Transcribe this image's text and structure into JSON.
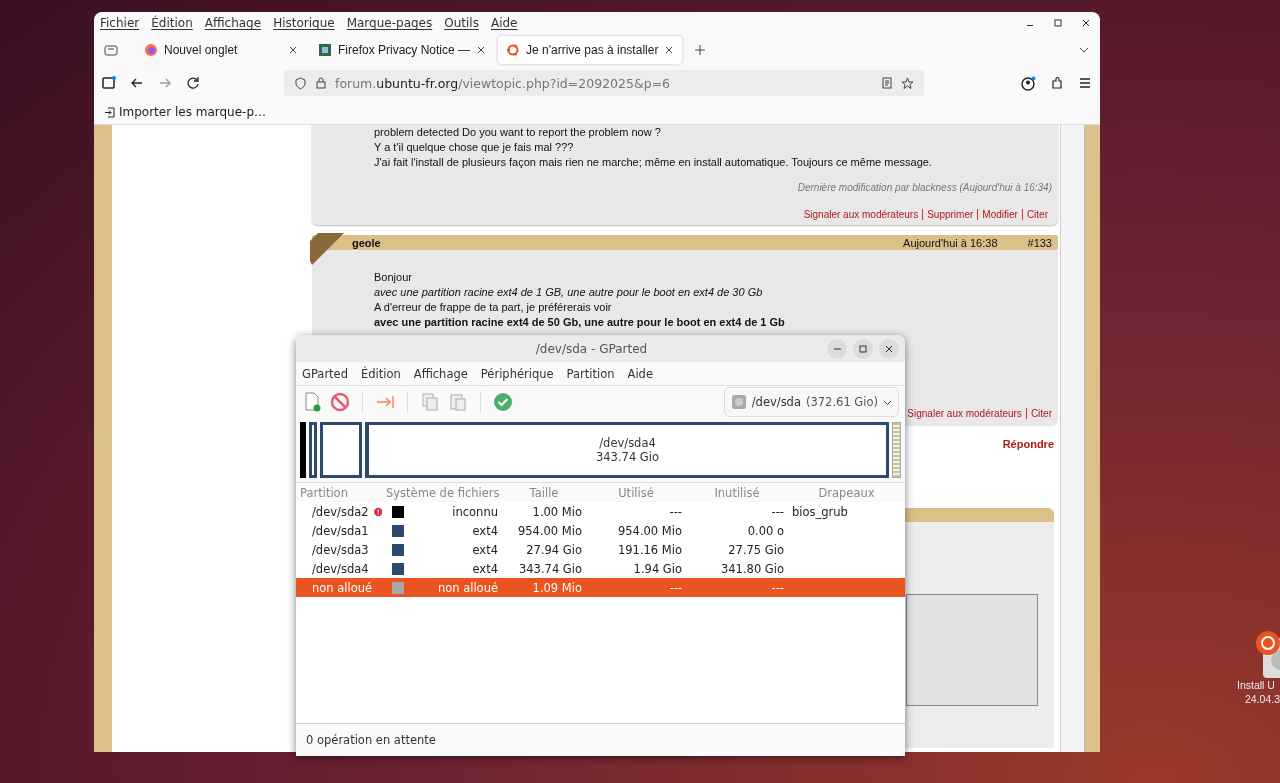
{
  "browser": {
    "menu": [
      "Fichier",
      "Édition",
      "Affichage",
      "Historique",
      "Marque-pages",
      "Outils",
      "Aide"
    ],
    "tabs": [
      {
        "title": "Nouvel onglet",
        "kind": "firefox",
        "selected": false
      },
      {
        "title": "Firefox Privacy Notice —",
        "kind": "privacy",
        "selected": false
      },
      {
        "title": "Je n'arrive pas à installer",
        "kind": "ubuntu",
        "selected": true
      }
    ],
    "url": {
      "prefix": "forum.",
      "domain": "ubuntu-fr.org",
      "path": "/viewtopic.php?id=2092025&p=6"
    },
    "bookmarks": [
      "Importer les marque-p…"
    ]
  },
  "forum": {
    "posts": [
      {
        "lines": [
          {
            "text": "problem detected  Do you want to report the problem now ?",
            "kind": "plain"
          },
          {
            "text": "Y a t'il quelque chose que je fais mal ???",
            "kind": "plain"
          },
          {
            "text": "J'ai fait l'install de plusieurs façon mais rien ne marche; même en install automatique. Toujours ce même message.",
            "kind": "plain"
          }
        ],
        "edit_note": "Dernière modification par blackness (Aujourd'hui à 16:34)",
        "actions": [
          "Signaler aux modérateurs",
          "Supprimer",
          "Modifier",
          "Citer"
        ]
      },
      {
        "author": "geole",
        "time": "Aujourd'hui à 16:38",
        "number": "#133",
        "lines": [
          {
            "text": "Bonjour",
            "kind": "plain"
          },
          {
            "text": "avec une partition racine ext4 de 1 GB, une autre pour le boot en ext4 de 30 Gb",
            "kind": "italic"
          },
          {
            "text": "A d'erreur de frappe de ta part, je préférerais voir",
            "kind": "plain"
          },
          {
            "text": "avec une partition racine ext4 de 50 Gb, une autre pour le boot en ext4 de 1 Gb",
            "kind": "bold"
          }
        ],
        "actions": [
          "Signaler aux modérateurs",
          "Citer"
        ]
      }
    ],
    "reply_link": "Répondre"
  },
  "gparted": {
    "title": "/dev/sda - GParted",
    "menu": [
      "GParted",
      "Édition",
      "Affichage",
      "Périphérique",
      "Partition",
      "Aide"
    ],
    "device": "/dev/sda",
    "device_size": "(372.61 Gio)",
    "map": {
      "label": "/dev/sda4",
      "size": "343.74 Gio"
    },
    "columns": [
      "Partition",
      "Système de fichiers",
      "Taille",
      "Utilisé",
      "Inutilisé",
      "Drapeaux"
    ],
    "rows": [
      {
        "partition": "/dev/sda2",
        "warning": true,
        "color": "#000000",
        "fs": "inconnu",
        "size": "1.00 Mio",
        "used": "---",
        "unused": "---",
        "flags": "bios_grub",
        "selected": false
      },
      {
        "partition": "/dev/sda1",
        "warning": false,
        "color": "#2c4a6e",
        "fs": "ext4",
        "size": "954.00 Mio",
        "used": "954.00 Mio",
        "unused": "0.00 o",
        "selected": false
      },
      {
        "partition": "/dev/sda3",
        "warning": false,
        "color": "#2c4a6e",
        "fs": "ext4",
        "size": "27.94 Gio",
        "used": "191.16 Mio",
        "unused": "27.75 Gio",
        "selected": false
      },
      {
        "partition": "/dev/sda4",
        "warning": false,
        "color": "#2c4a6e",
        "fs": "ext4",
        "size": "343.74 Gio",
        "used": "1.94 Gio",
        "unused": "341.80 Gio",
        "selected": false
      },
      {
        "partition": "non alloué",
        "warning": false,
        "color": "#a8a8a8",
        "fs": "non alloué",
        "size": "1.09 Mio",
        "used": "---",
        "unused": "---",
        "selected": true
      }
    ],
    "status": "0 opération en attente"
  },
  "desktop_icons": [
    {
      "label_lines": [
        "Install U",
        "24.04.3"
      ]
    }
  ]
}
